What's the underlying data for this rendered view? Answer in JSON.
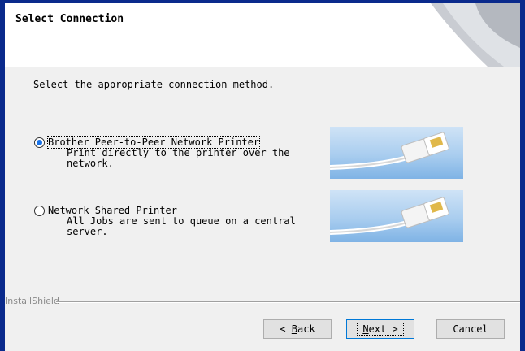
{
  "header": {
    "title": "Select Connection"
  },
  "instruction": "Select the appropriate connection method.",
  "options": [
    {
      "label": "Brother Peer-to-Peer Network Printer",
      "description": "Print directly to the printer over the network.",
      "selected": true,
      "image": "network-cable-image"
    },
    {
      "label": "Network Shared Printer",
      "description": "All Jobs are sent to queue on a central server.",
      "selected": false,
      "image": "network-cable-image"
    }
  ],
  "footer": {
    "brand": "InstallShield",
    "back_prefix": "< ",
    "back_key": "B",
    "back_rest": "ack",
    "next_key": "N",
    "next_rest": "ext >",
    "cancel_label": "Cancel"
  },
  "colors": {
    "title_bar": "#0a2a8c",
    "radio_selected": "#1a73e8",
    "image_bg": "#a9cdef"
  }
}
